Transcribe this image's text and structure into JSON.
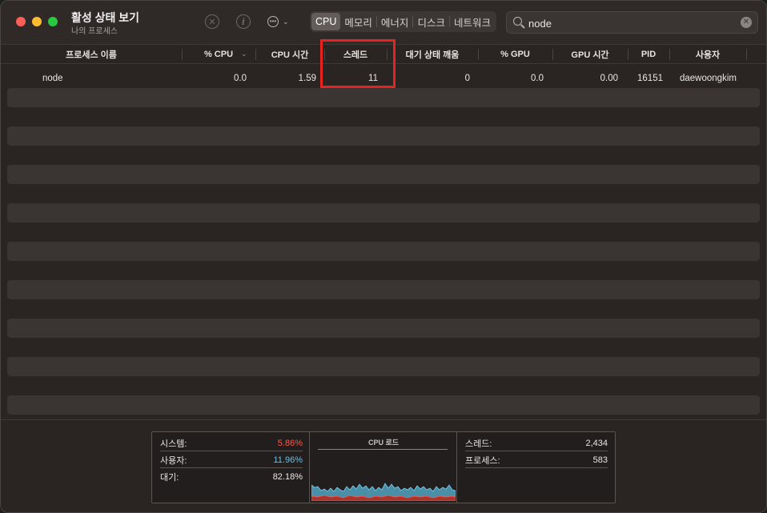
{
  "window": {
    "title": "활성 상태 보기",
    "subtitle": "나의 프로세스"
  },
  "toolbar": {
    "stop_icon": "x-circle-icon",
    "info_icon": "info-icon",
    "more_icon": "ellipsis-circle-icon",
    "tabs": [
      {
        "label": "CPU",
        "active": true
      },
      {
        "label": "메모리",
        "active": false
      },
      {
        "label": "에너지",
        "active": false
      },
      {
        "label": "디스크",
        "active": false
      },
      {
        "label": "네트워크",
        "active": false
      }
    ],
    "search": {
      "value": "node"
    }
  },
  "table": {
    "columns": [
      "프로세스 이름",
      "% CPU",
      "CPU 시간",
      "스레드",
      "대기 상태 깨움",
      "% GPU",
      "GPU 시간",
      "PID",
      "사용자"
    ],
    "rows": [
      {
        "name": "node",
        "cpu": "0.0",
        "cpu_time": "1.59",
        "threads": "11",
        "idle_wakeups": "0",
        "gpu": "0.0",
        "gpu_time": "0.00",
        "pid": "16151",
        "user": "daewoongkim"
      }
    ],
    "highlight_column": "스레드"
  },
  "stats": {
    "system": {
      "label": "시스템:",
      "value": "5.86%"
    },
    "user": {
      "label": "사용자:",
      "value": "11.96%"
    },
    "idle": {
      "label": "대기:",
      "value": "82.18%"
    },
    "cpu_load_title": "CPU 로드",
    "threads": {
      "label": "스레드:",
      "value": "2,434"
    },
    "processes": {
      "label": "프로세스:",
      "value": "583"
    }
  },
  "colors": {
    "system": "#ff5a4e",
    "user": "#5ac8f5",
    "highlight": "#e8231f"
  }
}
